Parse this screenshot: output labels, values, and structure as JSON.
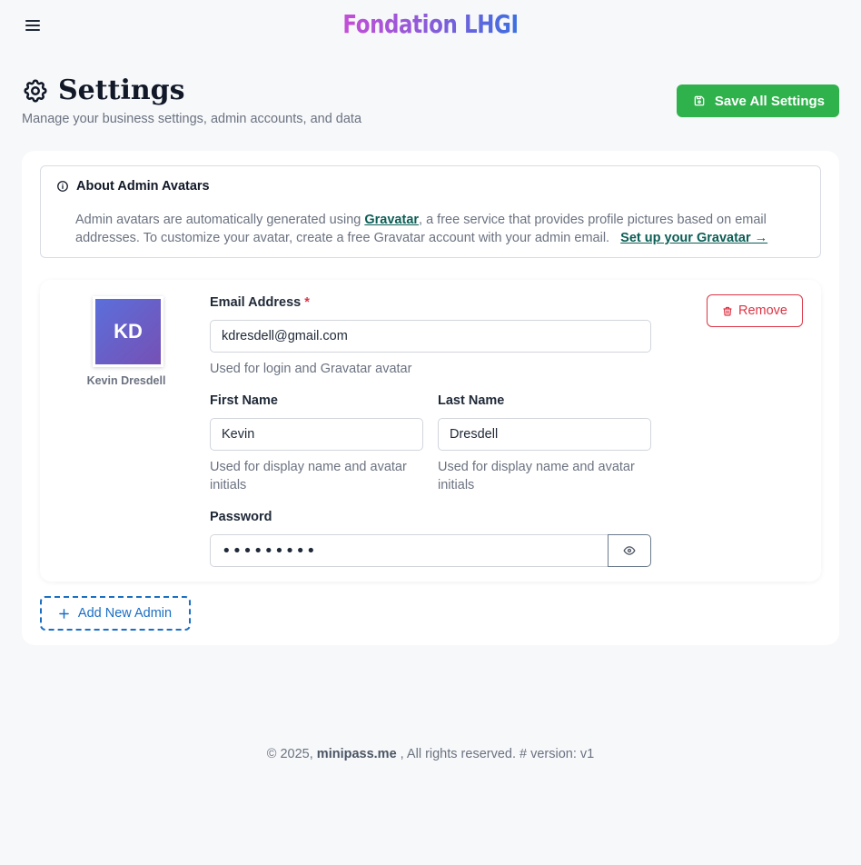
{
  "brand": {
    "name": "Fondation LHGI"
  },
  "header": {
    "title": "Settings",
    "subtitle": "Manage your business settings, admin accounts, and data",
    "save_label": "Save All Settings"
  },
  "info": {
    "title": "About Admin Avatars",
    "text_before": "Admin avatars are automatically generated using ",
    "gravatar_link": "Gravatar",
    "text_after": ", a free service that provides profile pictures based on email addresses. To customize your avatar, create a free Gravatar account with your admin email.",
    "setup_link": "Set up your Gravatar →"
  },
  "admin": {
    "initials": "KD",
    "display_name": "Kevin Dresdell",
    "email_label": "Email Address",
    "email_required_mark": "*",
    "email_value": "kdresdell@gmail.com",
    "email_help": "Used for login and Gravatar avatar",
    "first_name_label": "First Name",
    "first_name_value": "Kevin",
    "first_name_help": "Used for display name and avatar initials",
    "last_name_label": "Last Name",
    "last_name_value": "Dresdell",
    "last_name_help": "Used for display name and avatar initials",
    "password_label": "Password",
    "password_value": "•••••••••",
    "remove_label": "Remove"
  },
  "add_admin_label": "Add New Admin",
  "footer": {
    "prefix": "© 2025, ",
    "site": "minipass.me",
    "suffix": " , All rights reserved. # version: v1"
  },
  "colors": {
    "save_button": "#2fb24c",
    "remove": "#dc3545",
    "add_admin": "#1a6fc4",
    "link": "#0b5d55",
    "avatar_start": "#5b6fdb",
    "avatar_end": "#7650b4"
  },
  "icons": {
    "menu": "hamburger-menu-icon",
    "settings": "gear-icon",
    "save": "floppy-disk-icon",
    "info": "info-circle-icon",
    "remove": "trash-icon",
    "password_toggle": "eye-icon",
    "add": "plus-icon"
  }
}
